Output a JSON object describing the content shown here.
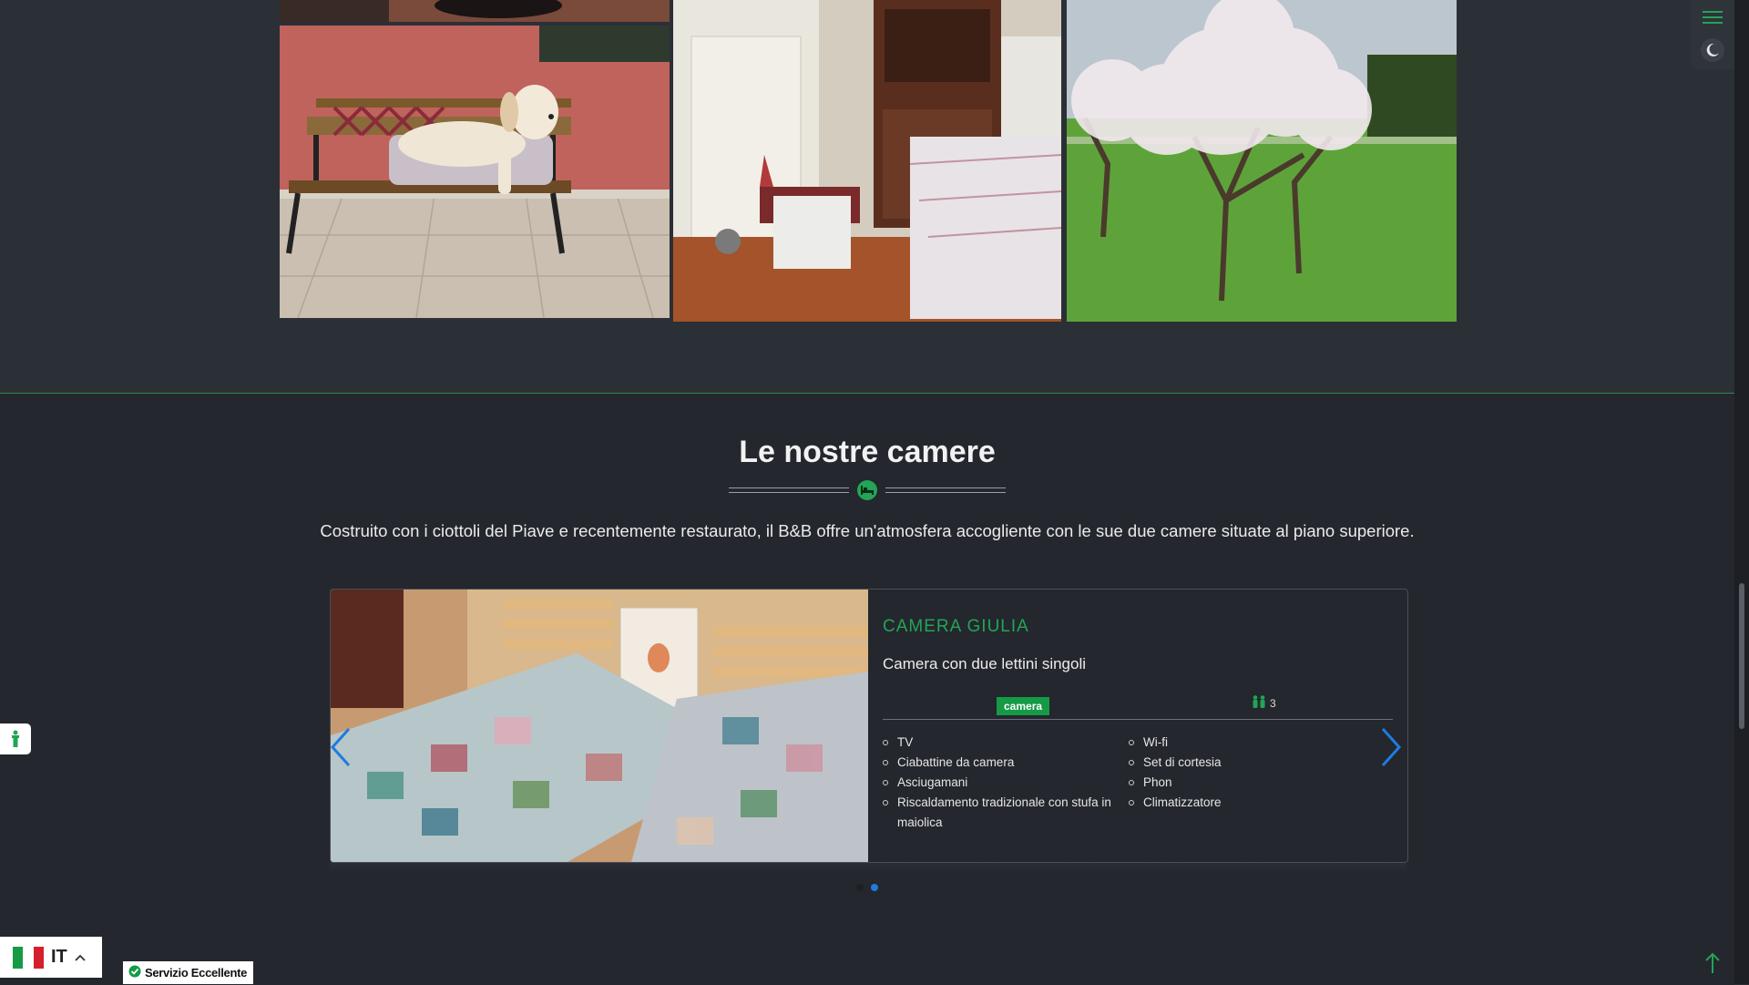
{
  "section": {
    "title": "Le nostre camere",
    "intro": "Costruito con i ciottoli del Piave e recentemente restaurato, il B&B offre un'atmosfera accogliente con le sue due camere situate al piano superiore."
  },
  "room": {
    "name": "CAMERA GIULIA",
    "description": "Camera con due lettini singoli",
    "tag": "camera",
    "guests": "3",
    "features_left": [
      "TV",
      "Ciabattine da camera",
      "Asciugamani",
      "Riscaldamento tradizionale con stufa in maiolica"
    ],
    "features_right": [
      "Wi-fi",
      "Set di cortesia",
      "Phon",
      "Climatizzatore"
    ]
  },
  "carousel": {
    "slide_count": 2,
    "active_index": 1
  },
  "language": {
    "code": "IT"
  },
  "badge": {
    "text": "Servizio Eccellente"
  },
  "colors": {
    "accent": "#22a556",
    "nav_arrow": "#1e7be0",
    "background": "#24272d"
  },
  "icons": {
    "divider": "bed-icon",
    "guests": "people-icon",
    "menu": "hamburger-icon",
    "theme": "moon-icon",
    "accessibility": "accessibility-icon",
    "language_toggle": "chevron-up-icon",
    "badge": "check-circle-icon",
    "scroll_top": "arrow-up-icon"
  }
}
